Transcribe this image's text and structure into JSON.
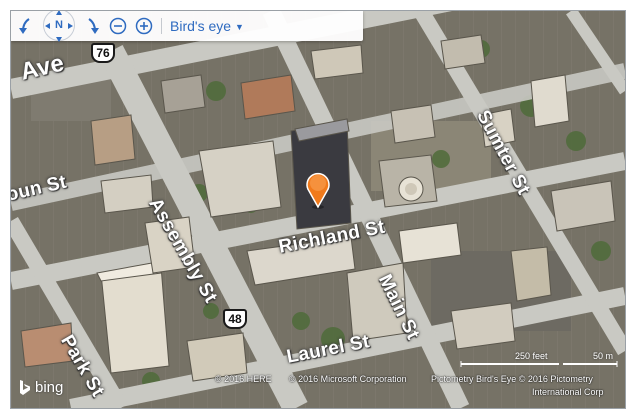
{
  "toolbar": {
    "rotate_left_icon": "rotate-left-arrow-icon",
    "compass_label": "N",
    "rotate_right_icon": "rotate-right-arrow-icon",
    "zoom_out_icon": "zoom-out-circle-icon",
    "zoom_in_icon": "zoom-in-circle-icon",
    "view_mode": "Bird's eye"
  },
  "streets": {
    "ave": "Ave",
    "bloun": "oun St",
    "assembly": "Assembly St",
    "richland": "Richland St",
    "main": "Main St",
    "sumter": "Sumter St",
    "park": "Park St",
    "laurel": "Laurel St"
  },
  "route_shields": {
    "us76": "76",
    "r48": "48"
  },
  "branding": {
    "logo_text": "bing"
  },
  "attribution": {
    "here": "© 2016 HERE",
    "microsoft": "© 2016 Microsoft Corporation",
    "pictometry_line1": "Pictometry Bird's Eye © 2016 Pictometry",
    "pictometry_line2": "International Corp"
  },
  "scale": {
    "feet": "250 feet",
    "meters": "50 m"
  },
  "colors": {
    "accent": "#2f6bc0",
    "pin": "#f07a1c",
    "road": "#c9c9c3",
    "roof": "#d8d4cb"
  }
}
